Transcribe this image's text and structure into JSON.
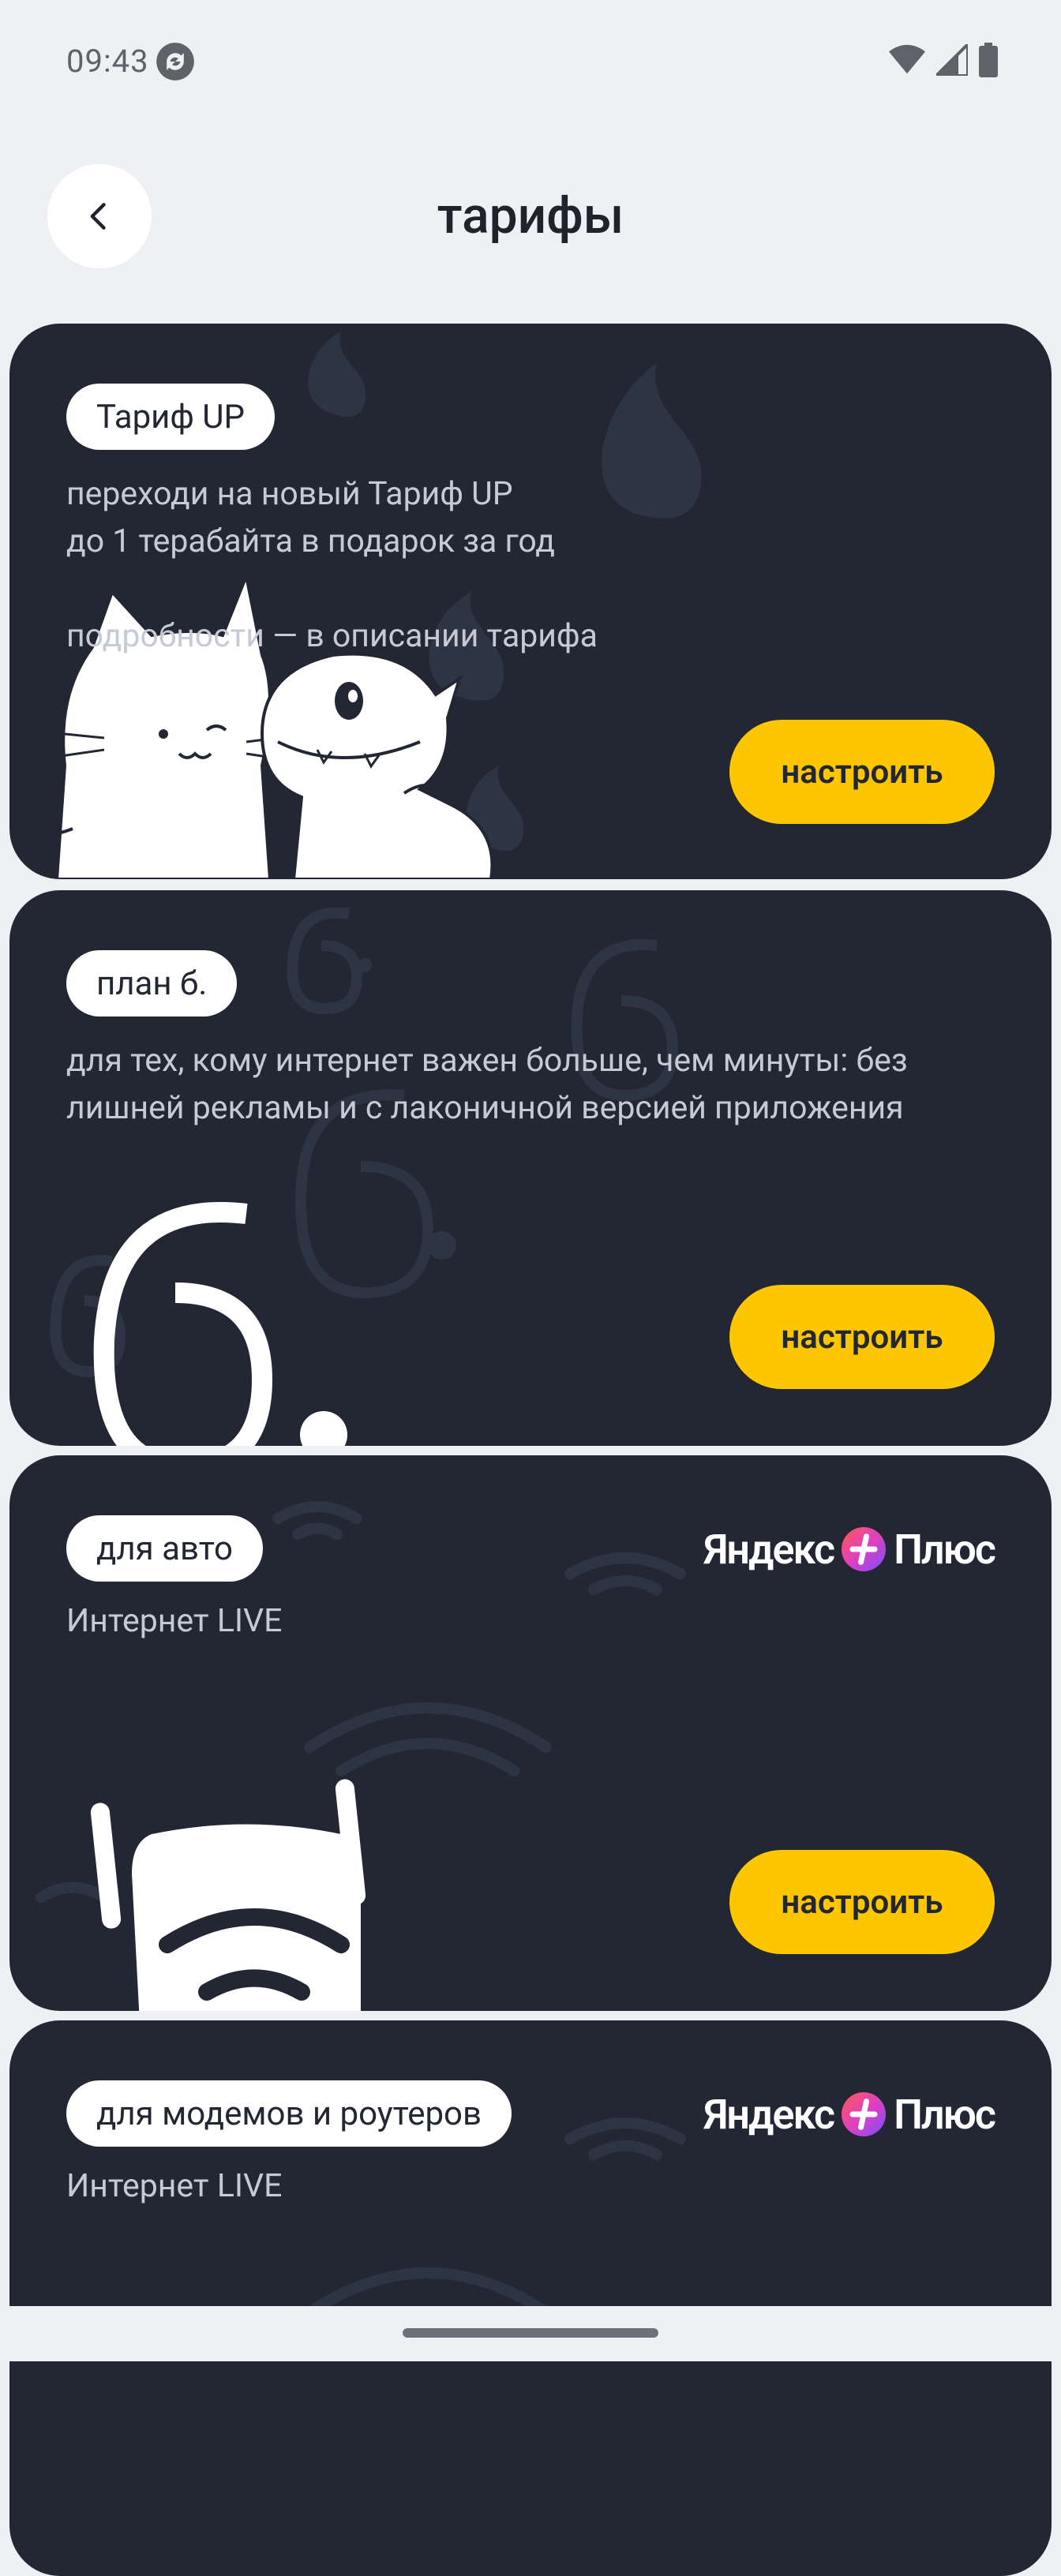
{
  "status_bar": {
    "time": "09:43",
    "icons": [
      "sync-icon",
      "wifi-icon",
      "signal-icon",
      "battery-icon"
    ]
  },
  "header": {
    "title": "тарифы",
    "back_icon": "chevron-left-icon"
  },
  "colors": {
    "background": "#eef0f3",
    "card": "#232733",
    "accent": "#fcc600",
    "pill": "#ffffff"
  },
  "cards": [
    {
      "tag": "Тариф UP",
      "lines": [
        "переходи на новый Тариф UP",
        "до 1 терабайта в подарок за год",
        "",
        "подробности — в описании тарифа"
      ],
      "button": "настроить",
      "illustration": "cat-and-lizard-illustration"
    },
    {
      "tag": "план б.",
      "lines": [
        "для тех, кому интернет важен больше, чем минуты: без",
        "лишней рекламы и с лаконичной версией приложения"
      ],
      "button": "настроить",
      "illustration": "big-b-letter-illustration"
    },
    {
      "tag": "для авто",
      "lines": [
        "Интернет LIVE"
      ],
      "partner_logo": "Яндекс Плюс",
      "partner_logo_left": "Яндекс",
      "partner_logo_right": "Плюс",
      "button": "настроить",
      "illustration": "router-illustration"
    },
    {
      "tag": "для модемов и роутеров",
      "lines": [
        "Интернет LIVE"
      ],
      "partner_logo": "Яндекс Плюс",
      "partner_logo_left": "Яндекс",
      "partner_logo_right": "Плюс"
    }
  ]
}
